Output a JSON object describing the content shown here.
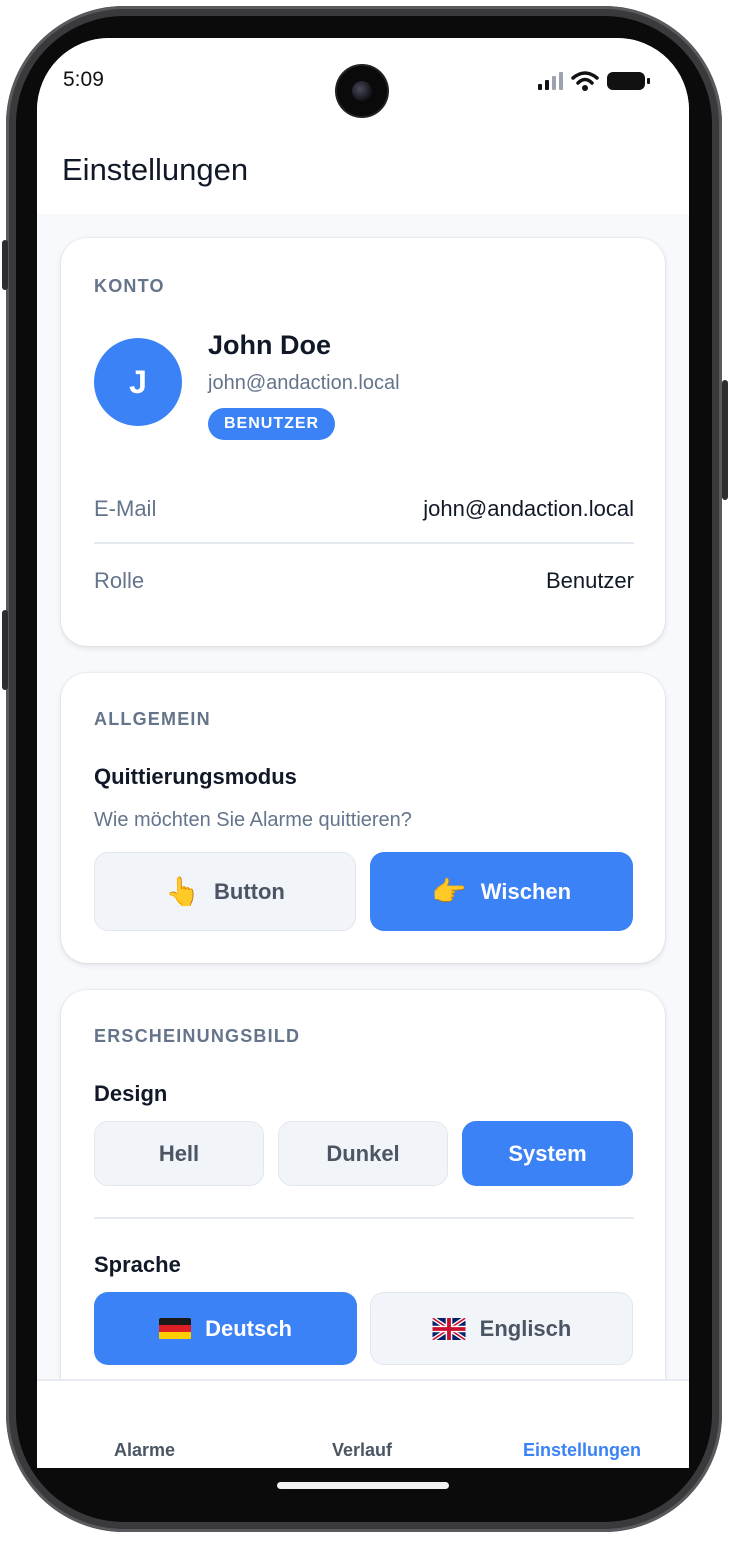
{
  "status_bar": {
    "time": "5:09"
  },
  "header": {
    "title": "Einstellungen"
  },
  "account": {
    "section_label": "KONTO",
    "avatar_initial": "J",
    "name": "John Doe",
    "email": "john@andaction.local",
    "role_badge": "BENUTZER",
    "rows": [
      {
        "label": "E-Mail",
        "value": "john@andaction.local"
      },
      {
        "label": "Rolle",
        "value": "Benutzer"
      }
    ]
  },
  "general": {
    "section_label": "ALLGEMEIN",
    "ack_mode_title": "Quittierungsmodus",
    "ack_mode_hint": "Wie möchten Sie Alarme quittieren?",
    "options": [
      {
        "label": "Button",
        "emoji": "👆",
        "selected": false
      },
      {
        "label": "Wischen",
        "emoji": "👉",
        "selected": true
      }
    ]
  },
  "appearance": {
    "section_label": "ERSCHEINUNGSBILD",
    "design_title": "Design",
    "design_options": [
      {
        "label": "Hell",
        "selected": false
      },
      {
        "label": "Dunkel",
        "selected": false
      },
      {
        "label": "System",
        "selected": true
      }
    ],
    "language_title": "Sprache",
    "language_options": [
      {
        "label": "Deutsch",
        "flag": "germany-flag-icon",
        "selected": true
      },
      {
        "label": "Englisch",
        "flag": "uk-flag-icon",
        "selected": false
      }
    ]
  },
  "bottom_nav": {
    "items": [
      {
        "label": "Alarme",
        "active": false
      },
      {
        "label": "Verlauf",
        "active": false
      },
      {
        "label": "Einstellungen",
        "active": true
      }
    ]
  },
  "colors": {
    "accent": "#3b82f6",
    "text_primary": "#111827",
    "text_muted": "#64748b",
    "background": "#f7f9fc"
  }
}
